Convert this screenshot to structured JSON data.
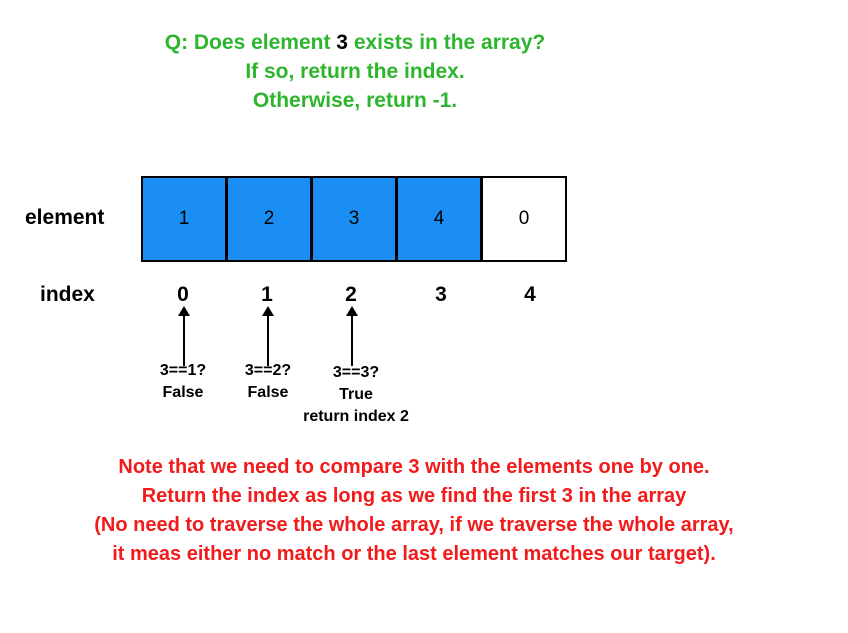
{
  "question": {
    "line1_prefix": "Q: Does element ",
    "target": "3",
    "line1_suffix": " exists in the array?",
    "line2": "If so, return the index.",
    "line3": "Otherwise, return -1."
  },
  "row_labels": {
    "element": "element",
    "index": "index"
  },
  "array": {
    "cells": [
      "1",
      "2",
      "3",
      "4",
      "0"
    ],
    "filled": [
      true,
      true,
      true,
      true,
      false
    ]
  },
  "indices": [
    "0",
    "1",
    "2",
    "3",
    "4"
  ],
  "comparisons": [
    {
      "check": "3==1?",
      "result": "False",
      "extra": ""
    },
    {
      "check": "3==2?",
      "result": "False",
      "extra": ""
    },
    {
      "check": "3==3?",
      "result": "True",
      "extra": "return index 2"
    }
  ],
  "note": {
    "line1": "Note that we need to compare 3 with the elements one by one.",
    "line2": "Return the index as long as we find the first 3 in the array",
    "line3": "(No need to traverse the whole array, if we traverse the whole array,",
    "line4": "it meas either no match or the last element matches our target)."
  },
  "colors": {
    "question": "#2db52d",
    "note": "#f21a1a",
    "cell_fill": "#1a8ef2",
    "text": "#000000"
  }
}
